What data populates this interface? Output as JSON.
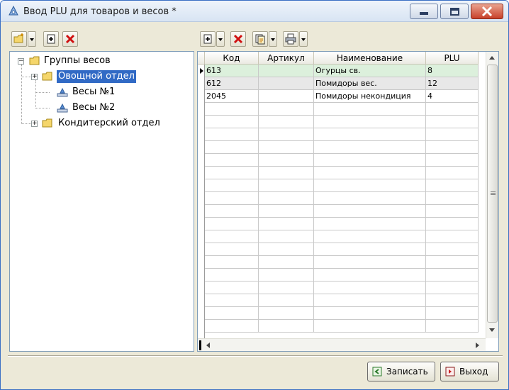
{
  "window": {
    "title": "Ввод PLU для товаров и весов *"
  },
  "left_toolbar": {
    "buttons": [
      "new-folder-icon",
      "add-icon",
      "delete-icon"
    ]
  },
  "right_toolbar": {
    "buttons": [
      "add-icon",
      "delete-icon",
      "copy-icon",
      "print-icon"
    ]
  },
  "tree": {
    "root": "Группы весов",
    "items": [
      {
        "label": "Овощной отдел",
        "selected": true
      },
      {
        "label": "Весы №1"
      },
      {
        "label": "Весы №2"
      },
      {
        "label": "Кондитерский отдел"
      }
    ]
  },
  "grid": {
    "columns": [
      "Код",
      "Артикул",
      "Наименование",
      "PLU"
    ],
    "rows": [
      {
        "code": "613",
        "article": "",
        "name": "Огурцы св.",
        "plu": "8"
      },
      {
        "code": "612",
        "article": "",
        "name": "Помидоры вес.",
        "plu": "12"
      },
      {
        "code": "2045",
        "article": "",
        "name": "Помидоры некондиция",
        "plu": "4"
      }
    ]
  },
  "footer": {
    "save_label": "Записать",
    "exit_label": "Выход"
  },
  "colors": {
    "selection": "#316ac5",
    "active_row": "#dcf0dc",
    "close_button": "#c8412a"
  }
}
